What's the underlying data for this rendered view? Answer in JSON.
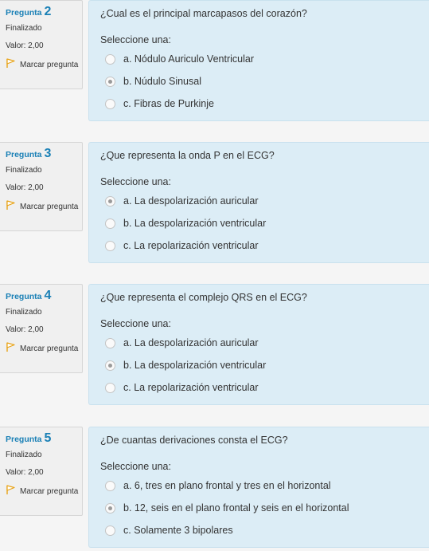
{
  "questions": [
    {
      "label": "Pregunta",
      "number": "2",
      "state": "Finalizado",
      "grade": "Valor: 2,00",
      "flag_label": "Marcar pregunta",
      "text": "¿Cual es el principal marcapasos del corazón?",
      "prompt": "Seleccione una:",
      "options": [
        {
          "text": "a. Nódulo Auriculo Ventricular",
          "checked": false
        },
        {
          "text": "b. Núdulo Sinusal",
          "checked": true
        },
        {
          "text": "c. Fibras de Purkinje",
          "checked": false
        }
      ]
    },
    {
      "label": "Pregunta",
      "number": "3",
      "state": "Finalizado",
      "grade": "Valor: 2,00",
      "flag_label": "Marcar pregunta",
      "text": "¿Que representa la onda P en el ECG?",
      "prompt": "Seleccione una:",
      "options": [
        {
          "text": "a. La despolarización auricular",
          "checked": true
        },
        {
          "text": "b. La despolarización ventricular",
          "checked": false
        },
        {
          "text": "c. La repolarización ventricular",
          "checked": false
        }
      ]
    },
    {
      "label": "Pregunta",
      "number": "4",
      "state": "Finalizado",
      "grade": "Valor: 2,00",
      "flag_label": "Marcar pregunta",
      "text": "¿Que representa el complejo QRS en el ECG?",
      "prompt": "Seleccione una:",
      "options": [
        {
          "text": "a. La despolarización auricular",
          "checked": false
        },
        {
          "text": "b. La despolarización ventricular",
          "checked": true
        },
        {
          "text": "c. La repolarización ventricular",
          "checked": false
        }
      ]
    },
    {
      "label": "Pregunta",
      "number": "5",
      "state": "Finalizado",
      "grade": "Valor: 2,00",
      "flag_label": "Marcar pregunta",
      "text": "¿De cuantas derivaciones consta el ECG?",
      "prompt": "Seleccione una:",
      "options": [
        {
          "text": "a. 6, tres en plano frontal y tres en el horizontal",
          "checked": false
        },
        {
          "text": "b. 12, seis en el plano frontal y seis en el horizontal",
          "checked": true
        },
        {
          "text": "c. Solamente 3 bipolares",
          "checked": false
        }
      ]
    }
  ],
  "colors": {
    "question_number": "#1a80b6",
    "content_bg": "#dcedf6",
    "info_bg": "#f0f0f0",
    "flag": "#e8a317"
  },
  "icons": {
    "flag": "flag-icon"
  }
}
